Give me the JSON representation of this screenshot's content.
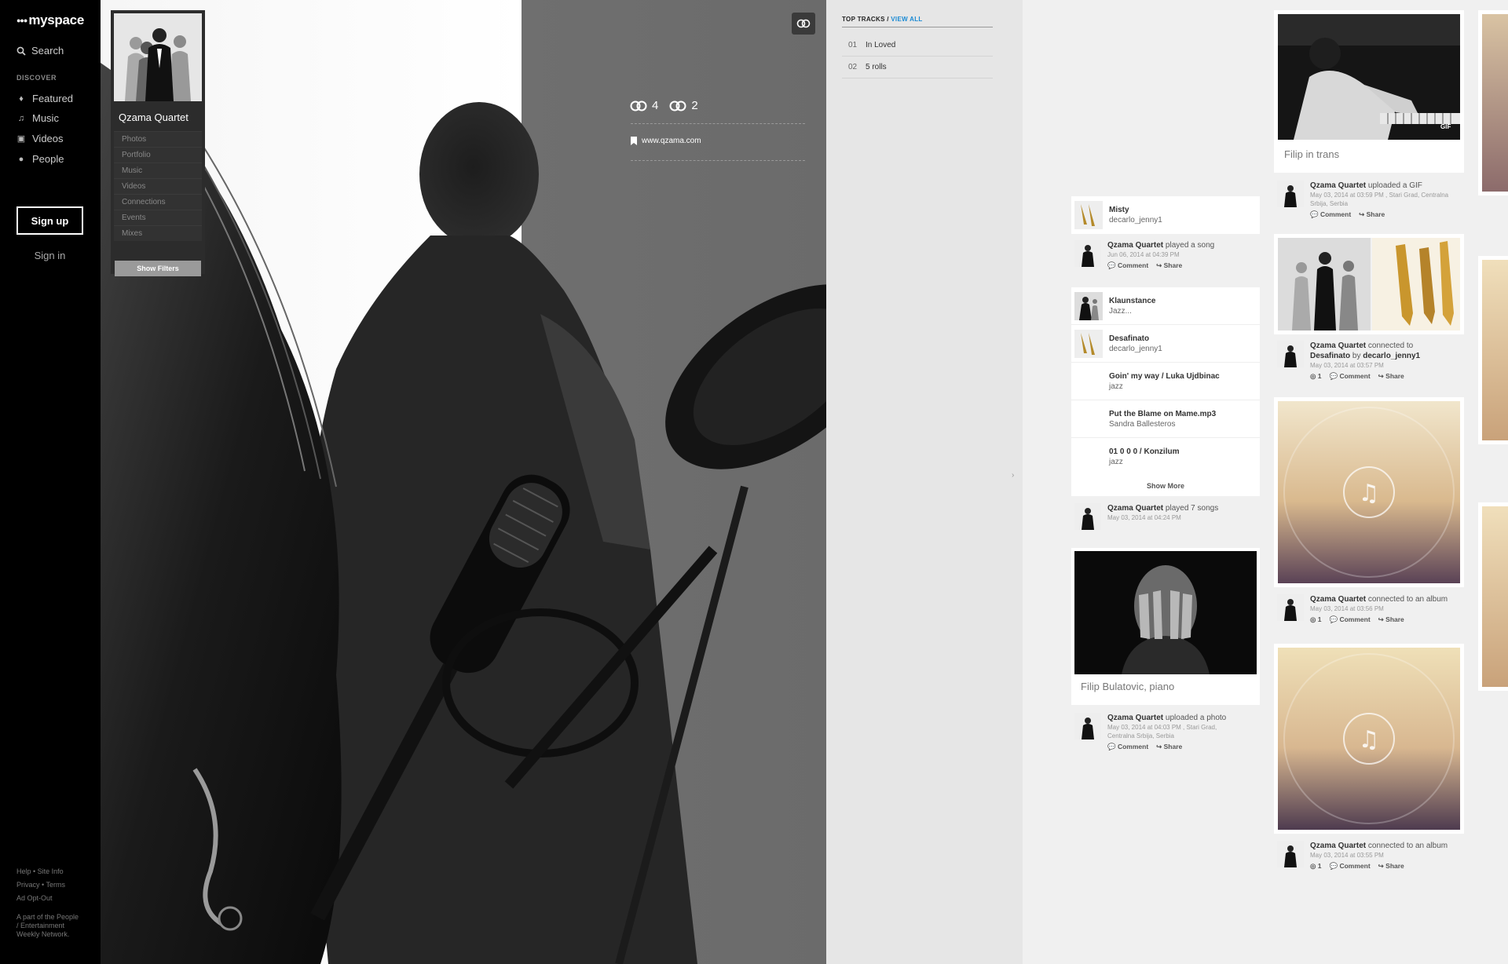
{
  "nav": {
    "logo": "myspace",
    "search": "Search",
    "discover": "DISCOVER",
    "items": [
      {
        "label": "Featured",
        "icon": "flame-icon"
      },
      {
        "label": "Music",
        "icon": "music-note-icon"
      },
      {
        "label": "Videos",
        "icon": "video-icon"
      },
      {
        "label": "People",
        "icon": "people-icon"
      }
    ],
    "signup": "Sign up",
    "signin": "Sign in",
    "footer": {
      "help": "Help",
      "site_info": "Site Info",
      "privacy": "Privacy",
      "terms": "Terms",
      "ad_opt_out": "Ad Opt-Out",
      "network": "A part of the People / Entertainment Weekly Network."
    }
  },
  "profile": {
    "name": "Qzama Quartet",
    "menu": [
      "Photos",
      "Portfolio",
      "Music",
      "Videos",
      "Connections",
      "Events",
      "Mixes"
    ],
    "show_filters": "Show Filters",
    "connections_in": "4",
    "connections_out": "2",
    "website": "www.qzama.com"
  },
  "tracks": {
    "heading": "TOP TRACKS",
    "sep": " / ",
    "view_all": "VIEW ALL",
    "list": [
      {
        "num": "01",
        "title": "In Loved"
      },
      {
        "num": "02",
        "title": "5 rolls"
      }
    ]
  },
  "feed": {
    "col1": {
      "song1": {
        "title": "Misty",
        "sub": "decarlo_jenny1"
      },
      "act1": {
        "who": "Qzama Quartet",
        "what": " played a song",
        "meta": "Jun 06, 2014 at 04:39 PM"
      },
      "songs": [
        {
          "title": "Klaunstance",
          "sub": "Jazz..."
        },
        {
          "title": "Desafinato",
          "sub": "decarlo_jenny1"
        },
        {
          "title": "Goin' my way / Luka Ujdbinac",
          "sub": "jazz"
        },
        {
          "title": "Put the Blame on Mame.mp3",
          "sub": "Sandra Ballesteros"
        },
        {
          "title": "01 0 0 0 / Konzilum",
          "sub": "jazz"
        }
      ],
      "show_more": "Show More",
      "act2": {
        "who": "Qzama Quartet",
        "what": " played 7 songs",
        "meta": "May 03, 2014 at 04:24 PM"
      },
      "photo_caption": "Filip Bulatovic, piano",
      "act3": {
        "who": "Qzama Quartet",
        "what": " uploaded a photo",
        "meta": "May 03, 2014 at 04:03 PM , Stari Grad, Centralna Srbija, Serbia"
      }
    },
    "col2": {
      "gif_caption": "Filip in trans",
      "gif_tag": "GIF",
      "act1": {
        "who": "Qzama Quartet",
        "what": " uploaded a GIF",
        "meta": "May 03, 2014 at 03:59 PM , Stari Grad, Centralna Srbija, Serbia"
      },
      "act2": {
        "who": "Qzama Quartet",
        "what": " connected to",
        "target": "Desafinato",
        "by": " by ",
        "target2": "decarlo_jenny1",
        "meta": "May 03, 2014 at 03:57 PM",
        "count": "1"
      },
      "act3": {
        "who": "Qzama Quartet",
        "what": " connected to an album",
        "meta": "May 03, 2014 at 03:56 PM",
        "count": "1"
      },
      "act4": {
        "who": "Qzama Quartet",
        "what": " connected to an album",
        "meta": "May 03, 2014 at 03:55 PM",
        "count": "1"
      }
    },
    "comment": "Comment",
    "share": "Share"
  }
}
